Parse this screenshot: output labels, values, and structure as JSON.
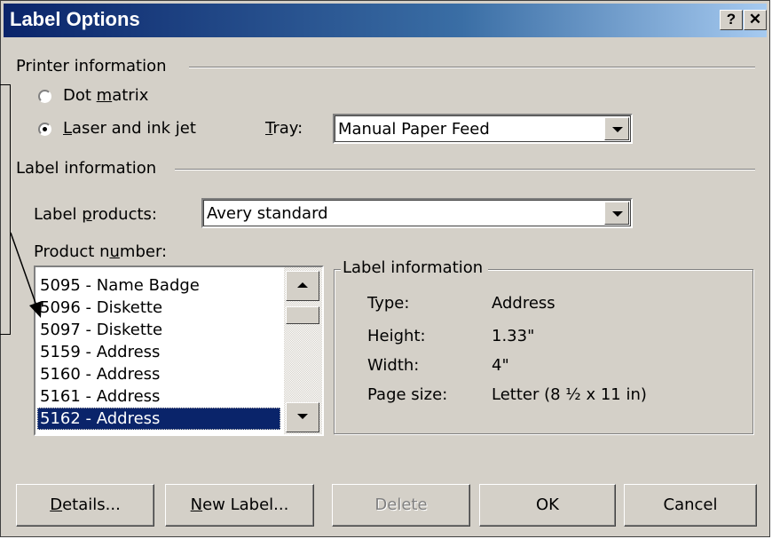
{
  "window": {
    "title": "Label Options",
    "help_btn": "?",
    "close_btn": "✕"
  },
  "printer_info": {
    "group_label": "Printer information",
    "dot_matrix": {
      "before": "Dot ",
      "mnemonic": "m",
      "after": "atrix",
      "selected": false
    },
    "laser": {
      "before": "",
      "mnemonic": "L",
      "after": "aser and ink jet",
      "selected": true
    },
    "tray": {
      "mnemonic": "T",
      "after": "ray:",
      "value": "Manual Paper Feed"
    }
  },
  "label_info": {
    "group_label": "Label information",
    "products": {
      "before": "Label ",
      "mnemonic": "p",
      "after": "roducts:",
      "value": "Avery standard"
    },
    "product_number": {
      "before": "Product n",
      "mnemonic": "u",
      "after": "mber:"
    },
    "items": [
      "5095 - Name Badge",
      "5096 - Diskette",
      "5097 - Diskette",
      "5159 - Address",
      "5160 - Address",
      "5161 - Address",
      "5162 - Address"
    ],
    "selected_item": "5162 - Address"
  },
  "details_panel": {
    "title": "Label information",
    "type": {
      "label": "Type:",
      "value": "Address"
    },
    "height": {
      "label": "Height:",
      "value": "1.33\""
    },
    "width": {
      "label": "Width:",
      "value": "4\""
    },
    "page_size": {
      "label": "Page size:",
      "value": "Letter (8 ½ x 11 in)"
    }
  },
  "buttons": {
    "details": {
      "mnemonic": "D",
      "after": "etails..."
    },
    "new_label": {
      "mnemonic": "N",
      "after": "ew Label..."
    },
    "delete": "Delete",
    "ok": "OK",
    "cancel": "Cancel"
  },
  "colors": {
    "title_bar": "#0a246a",
    "dialog_face": "#d4d0c8",
    "selection": "#0a246a"
  },
  "icons": [
    "help-icon",
    "close-icon",
    "chevron-down-icon",
    "scroll-up-arrow-icon",
    "scroll-down-arrow-icon",
    "callout-arrow-icon"
  ]
}
